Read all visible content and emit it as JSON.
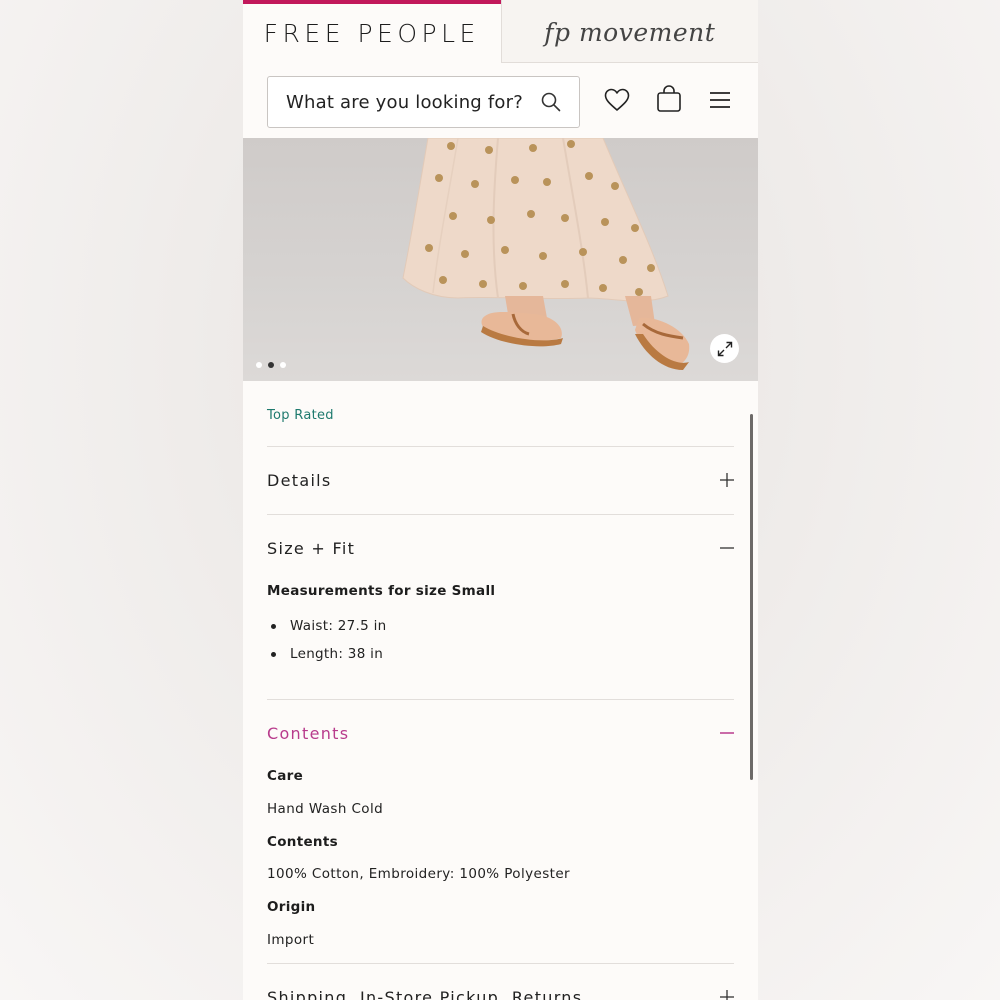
{
  "brand_tabs": {
    "free_people": "FREE PEOPLE",
    "fp_movement": "fp movement"
  },
  "search": {
    "placeholder": "What are you looking for?"
  },
  "colors": {
    "accent": "#c2185b",
    "badge": "#1f7a6e",
    "active_section": "#b83b8c"
  },
  "gallery": {
    "total_images": 3,
    "active_index": 2
  },
  "product": {
    "badge": "Top Rated"
  },
  "accordion": {
    "details": {
      "title": "Details",
      "state": "collapsed"
    },
    "size_fit": {
      "title": "Size + Fit",
      "state": "expanded",
      "heading": "Measurements for size Small",
      "items": [
        "Waist: 27.5 in",
        "Length: 38 in"
      ]
    },
    "contents": {
      "title": "Contents",
      "state": "expanded",
      "care_label": "Care",
      "care_value": "Hand Wash Cold",
      "contents_label": "Contents",
      "contents_value": "100% Cotton, Embroidery: 100% Polyester",
      "origin_label": "Origin",
      "origin_value": "Import"
    },
    "shipping": {
      "title": "Shipping, In-Store Pickup, Returns",
      "state": "collapsed"
    }
  },
  "icons": {
    "search": "search-icon",
    "wishlist": "heart-icon",
    "bag": "shopping-bag-icon",
    "menu": "hamburger-menu-icon",
    "expand": "expand-icon",
    "plus": "plus-icon",
    "minus": "minus-icon"
  }
}
